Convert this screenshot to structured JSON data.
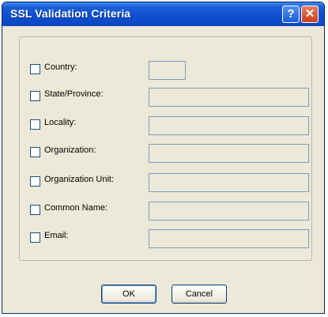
{
  "window": {
    "title": "SSL Validation Criteria",
    "help_glyph": "?",
    "close_glyph": "✕"
  },
  "criteria": [
    {
      "label": "Country:",
      "checked": false,
      "value": ""
    },
    {
      "label": "State/Province:",
      "checked": false,
      "value": ""
    },
    {
      "label": "Locality:",
      "checked": false,
      "value": ""
    },
    {
      "label": "Organization:",
      "checked": false,
      "value": ""
    },
    {
      "label": "Organization Unit:",
      "checked": false,
      "value": ""
    },
    {
      "label": "Common Name:",
      "checked": false,
      "value": ""
    },
    {
      "label": "Email:",
      "checked": false,
      "value": ""
    }
  ],
  "buttons": {
    "ok": "OK",
    "cancel": "Cancel"
  },
  "icons": {
    "help": "help-icon",
    "close": "close-icon"
  },
  "colors": {
    "titlebar": "#0a46c2",
    "dialog_bg": "#ece9d8",
    "field_border": "#7f9db9"
  }
}
